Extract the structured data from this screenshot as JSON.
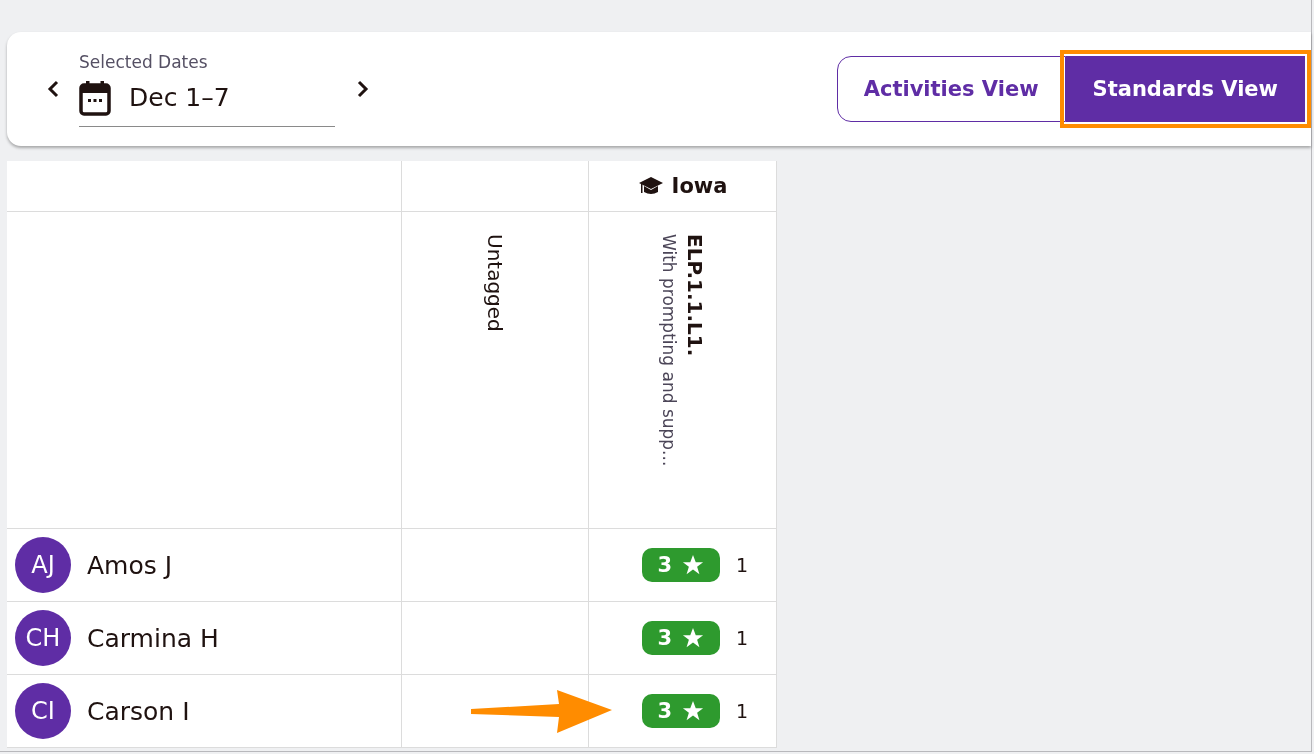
{
  "date_picker": {
    "label": "Selected Dates",
    "value": "Dec 1–7"
  },
  "view_toggle": [
    {
      "label": "Activities View",
      "selected": false,
      "highlighted": false
    },
    {
      "label": "Standards View",
      "selected": true,
      "highlighted": true
    }
  ],
  "table": {
    "group_header": "Iowa",
    "columns": [
      {
        "kind": "plain",
        "title": "Untagged"
      },
      {
        "kind": "standard",
        "title": "ELP.1.1.L1.",
        "subtitle": "With prompting and supp..."
      }
    ],
    "rows": [
      {
        "initials": "AJ",
        "name": "Amos J",
        "score": "3",
        "count": "1",
        "arrow": false
      },
      {
        "initials": "CH",
        "name": "Carmina H",
        "score": "3",
        "count": "1",
        "arrow": false
      },
      {
        "initials": "CI",
        "name": "Carson I",
        "score": "3",
        "count": "1",
        "arrow": true
      }
    ]
  }
}
